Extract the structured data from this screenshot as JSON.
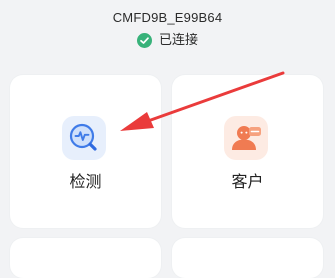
{
  "header": {
    "device_name": "CMFD9B_E99B64",
    "status_text": "已连接",
    "status_icon": "check-circle-icon",
    "status_color": "#38b27a"
  },
  "tiles": [
    {
      "label": "检测",
      "icon": "detect-search-icon",
      "icon_bg": "#e7effc",
      "accent": "#3f7be8"
    },
    {
      "label": "客户",
      "icon": "customer-person-icon",
      "icon_bg": "#fdebe3",
      "accent": "#f07b52"
    }
  ],
  "annotation": {
    "arrow_color": "#ea3b3b"
  }
}
